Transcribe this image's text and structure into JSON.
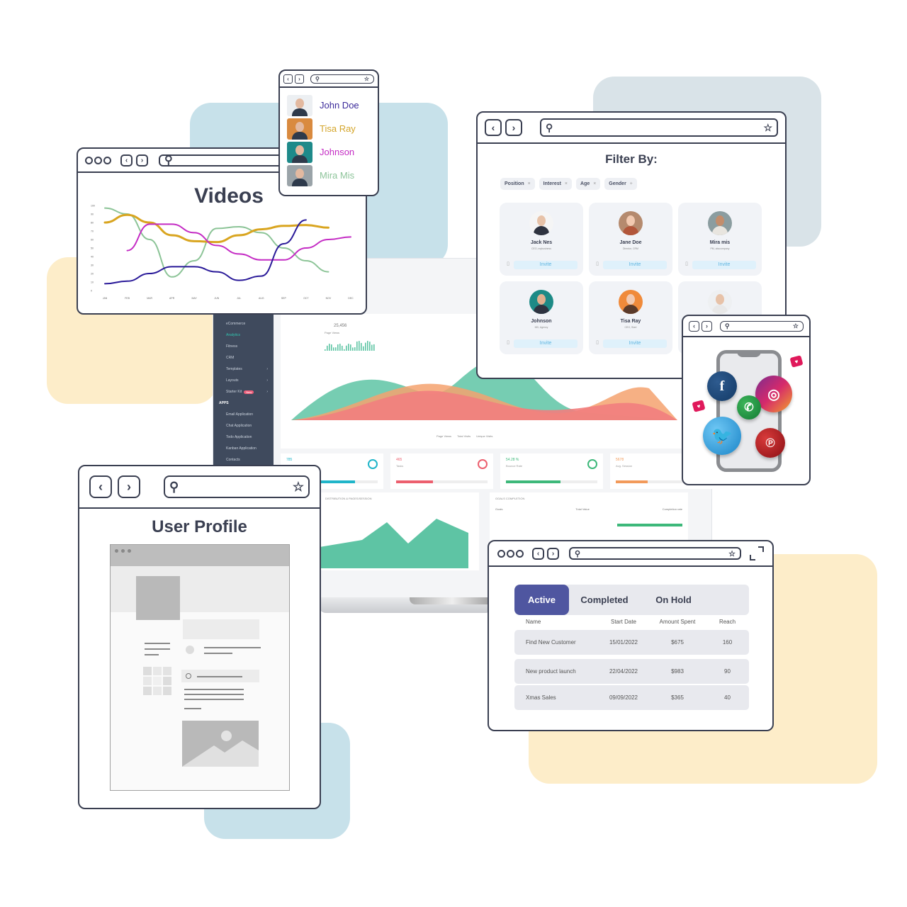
{
  "colors": {
    "outline": "#3a3f51",
    "accent_tab": "#4f56a0",
    "sidebar_bg": "#3f4a5d",
    "teal": "#5ec4a4",
    "salmon": "#f27e7e",
    "orange": "#f5a26e"
  },
  "contacts_window": {
    "icons": [
      "chevron-left-icon",
      "chevron-right-icon",
      "search-icon",
      "star-icon"
    ],
    "contacts": [
      {
        "name": "John Doe",
        "color": "#3b2a9a"
      },
      {
        "name": "Tisa Ray",
        "color": "#d4a52a"
      },
      {
        "name": "Johnson",
        "color": "#c42bc4"
      },
      {
        "name": "Mira Mis",
        "color": "#8dc49a"
      }
    ]
  },
  "videos_window": {
    "title": "Videos",
    "chart_data": {
      "type": "line",
      "title": "Videos",
      "categories": [
        "JAN",
        "FEB",
        "MAR",
        "APR",
        "MAY",
        "JUN",
        "JUL",
        "AUG",
        "SEP",
        "OCT",
        "NOV",
        "DEC"
      ],
      "y_ticks": [
        "0",
        "10",
        "20",
        "30",
        "40",
        "50",
        "60",
        "70",
        "80",
        "90",
        "100"
      ],
      "ylim": [
        0,
        100
      ],
      "series": [
        {
          "name": "green",
          "color": "#8cc497",
          "values": [
            97,
            90,
            60,
            16,
            35,
            73,
            75,
            68,
            50,
            35,
            22,
            null
          ]
        },
        {
          "name": "gold",
          "color": "#d9a520",
          "values": [
            80,
            89,
            80,
            65,
            58,
            57,
            65,
            72,
            76,
            77,
            74,
            null
          ]
        },
        {
          "name": "magenta",
          "color": "#c42bc4",
          "values": [
            null,
            47,
            78,
            78,
            68,
            53,
            43,
            36,
            36,
            50,
            60,
            63
          ]
        },
        {
          "name": "navy",
          "color": "#2a1a99",
          "values": [
            8,
            11,
            20,
            28,
            28,
            22,
            12,
            17,
            55,
            83,
            null,
            null
          ]
        }
      ]
    }
  },
  "filter_window": {
    "title": "Filter By:",
    "chips": [
      {
        "label": "Position",
        "icon": "close-icon"
      },
      {
        "label": "Interest",
        "icon": "close-icon"
      },
      {
        "label": "Age",
        "icon": "close-icon"
      },
      {
        "label": "Gender",
        "icon": "plus-icon"
      }
    ],
    "people": [
      {
        "name": "Jack Nes",
        "role": "CEO, mybusiness",
        "bg": "#f5f5f5",
        "skin": "#e7c2a8",
        "cloth": "#2e3340",
        "action": "Invite"
      },
      {
        "name": "Jane Doe",
        "role": "Director, CRM",
        "bg": "#b58a6e",
        "skin": "#f2c9b0",
        "cloth": "#b2563a",
        "action": "Invite"
      },
      {
        "name": "Mira mis",
        "role": "PM, abccompany",
        "bg": "#8b9da0",
        "skin": "#c28d6c",
        "cloth": "#e8e5df",
        "action": "Invite"
      },
      {
        "name": "Johnson",
        "role": "MD, Agency",
        "bg": "#1d8a86",
        "skin": "#e0b08f",
        "cloth": "#2e3340",
        "action": "Invite"
      },
      {
        "name": "Tisa Ray",
        "role": "CEO, Start",
        "bg": "#f08a3a",
        "skin": "#f2c9b0",
        "cloth": "#5a3a2a",
        "action": "Invite"
      },
      {
        "name": "",
        "role": "",
        "bg": "#eef0f2",
        "skin": "#e7c2a8",
        "cloth": "#e8e8e8",
        "action": ""
      }
    ]
  },
  "social_window": {
    "icons": [
      "facebook-icon",
      "instagram-icon",
      "whatsapp-icon",
      "twitter-icon",
      "pinterest-icon",
      "heart-icon"
    ]
  },
  "profile_window": {
    "title": "User Profile"
  },
  "table_window": {
    "tabs": [
      "Active",
      "Completed",
      "On Hold"
    ],
    "active_tab": "Active",
    "columns": [
      "Name",
      "Start Date",
      "Amount Spent",
      "Reach"
    ],
    "rows": [
      {
        "name": "Find New Customer",
        "start_date": "15/01/2022",
        "amount": "$675",
        "reach": "160"
      },
      {
        "name": "New product launch",
        "start_date": "22/04/2022",
        "amount": "$983",
        "reach": "90"
      },
      {
        "name": "Xmas Sales",
        "start_date": "09/09/2022",
        "amount": "$365",
        "reach": "40"
      }
    ]
  },
  "dashboard": {
    "sidebar": [
      {
        "label": "eCommerce",
        "active": false
      },
      {
        "label": "Analytics",
        "active": true
      },
      {
        "label": "Fitness",
        "active": false
      },
      {
        "label": "CRM",
        "active": false
      },
      {
        "label": "Templates",
        "active": false,
        "chevron": true
      },
      {
        "label": "Layouts",
        "active": false,
        "chevron": true
      },
      {
        "label": "Starter Kit",
        "active": false,
        "badge": "New",
        "chevron": true
      }
    ],
    "apps_heading": "APPS",
    "apps": [
      "Email Application",
      "Chat Application",
      "Todo Application",
      "Kanban Application",
      "Contacts"
    ],
    "headline_value": "25,456",
    "headline_label": "Page Views",
    "area_chart_legend": [
      "Page Views",
      "Total Visits",
      "Unique Visits"
    ],
    "stats": [
      {
        "value": "785",
        "label": "",
        "color": "#1fb5c9",
        "progress": 0.75
      },
      {
        "value": "465",
        "label": "Tasks",
        "color": "#ec5f6e",
        "progress": 0.4
      },
      {
        "value": "54.28 %",
        "label": "Bounce Rate",
        "color": "#3db87a",
        "progress": 0.6
      },
      {
        "value": "5678",
        "label": "Avg. Session",
        "color": "#f29a5a",
        "progress": 0.35
      }
    ],
    "panel_left_title": "DISTRIBUTION & PAGES/SESSION",
    "panel_right_title": "GOALS COMPLETION",
    "goal_columns": [
      "Goals",
      "Total Value",
      "Completion rate"
    ]
  }
}
